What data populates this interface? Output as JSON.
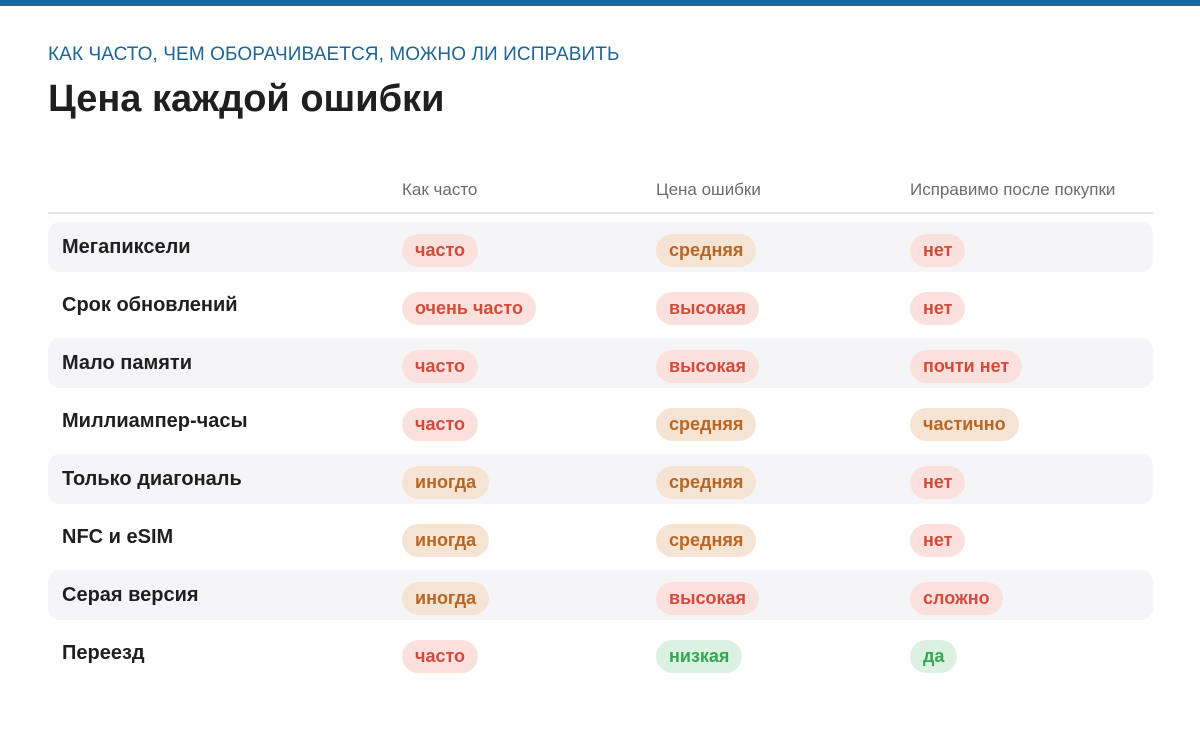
{
  "header": {
    "kicker": "КАК ЧАСТО, ЧЕМ ОБОРАЧИВАЕТСЯ, МОЖНО ЛИ ИСПРАВИТЬ",
    "title": "Цена каждой ошибки"
  },
  "colors": {
    "accent": "#1e6597",
    "red_text": "#d64a3a",
    "red_bg": "#fbe1de",
    "orange_text": "#b96625",
    "orange_bg": "#f5e3d3",
    "green_text": "#36a653",
    "green_bg": "#dcf1e1"
  },
  "table": {
    "columns": [
      "",
      "Как часто",
      "Цена ошибки",
      "Исправимо после покупки"
    ],
    "rows": [
      {
        "name": "Мегапиксели",
        "frequency": {
          "text": "часто",
          "tone": "red"
        },
        "cost": {
          "text": "средняя",
          "tone": "orange"
        },
        "fixable": {
          "text": "нет",
          "tone": "red"
        }
      },
      {
        "name": "Срок обновлений",
        "frequency": {
          "text": "очень часто",
          "tone": "red"
        },
        "cost": {
          "text": "высокая",
          "tone": "red"
        },
        "fixable": {
          "text": "нет",
          "tone": "red"
        }
      },
      {
        "name": "Мало памяти",
        "frequency": {
          "text": "часто",
          "tone": "red"
        },
        "cost": {
          "text": "высокая",
          "tone": "red"
        },
        "fixable": {
          "text": "почти нет",
          "tone": "red"
        }
      },
      {
        "name": "Миллиампер-часы",
        "frequency": {
          "text": "часто",
          "tone": "red"
        },
        "cost": {
          "text": "средняя",
          "tone": "orange"
        },
        "fixable": {
          "text": "частично",
          "tone": "orange"
        }
      },
      {
        "name": "Только диагональ",
        "frequency": {
          "text": "иногда",
          "tone": "orange"
        },
        "cost": {
          "text": "средняя",
          "tone": "orange"
        },
        "fixable": {
          "text": "нет",
          "tone": "red"
        }
      },
      {
        "name": "NFC и eSIM",
        "frequency": {
          "text": "иногда",
          "tone": "orange"
        },
        "cost": {
          "text": "средняя",
          "tone": "orange"
        },
        "fixable": {
          "text": "нет",
          "tone": "red"
        }
      },
      {
        "name": "Серая версия",
        "frequency": {
          "text": "иногда",
          "tone": "orange"
        },
        "cost": {
          "text": "высокая",
          "tone": "red"
        },
        "fixable": {
          "text": "сложно",
          "tone": "red"
        }
      },
      {
        "name": "Переезд",
        "frequency": {
          "text": "часто",
          "tone": "red"
        },
        "cost": {
          "text": "низкая",
          "tone": "green"
        },
        "fixable": {
          "text": "да",
          "tone": "green"
        }
      }
    ]
  }
}
